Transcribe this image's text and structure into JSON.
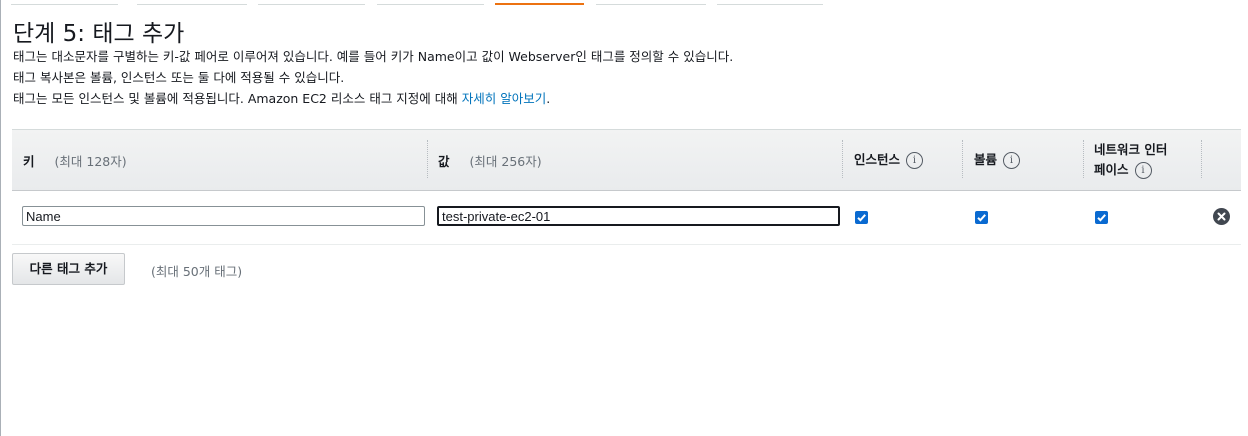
{
  "page": {
    "title": "단계 5: 태그 추가",
    "desc_line1": "태그는 대소문자를 구별하는 키-값 페어로 이루어져 있습니다. 예를 들어 키가 Name이고 값이 Webserver인 태그를 정의할 수 있습니다.",
    "desc_line2": "태그 복사본은 볼륨, 인스턴스 또는 둘 다에 적용될 수 있습니다.",
    "desc_line3": "태그는 모든 인스턴스 및 볼륨에 적용됩니다. Amazon EC2 리소스 태그 지정에 대해 ",
    "learn_more_link": "자세히 알아보기",
    "desc_line3_end": "."
  },
  "steps": {
    "active_index": 4,
    "count": 7,
    "accent_color": "#ec7211"
  },
  "table": {
    "headers": {
      "key": "키",
      "key_hint": "(최대 128자)",
      "value": "값",
      "value_hint": "(최대 256자)",
      "instances": "인스턴스",
      "volumes": "볼륨",
      "network_line1": "네트워크 인터",
      "network_line2": "페이스"
    },
    "info_icon": "i",
    "rows": [
      {
        "key": "Name",
        "value": "test-private-ec2-01",
        "instances": true,
        "volumes": true,
        "network_interfaces": true
      }
    ]
  },
  "footer": {
    "add_button": "다른 태그 추가",
    "max_note": "(최대 50개 태그)"
  },
  "colors": {
    "link": "#0073bb",
    "checkbox": "#0a6ad1"
  }
}
